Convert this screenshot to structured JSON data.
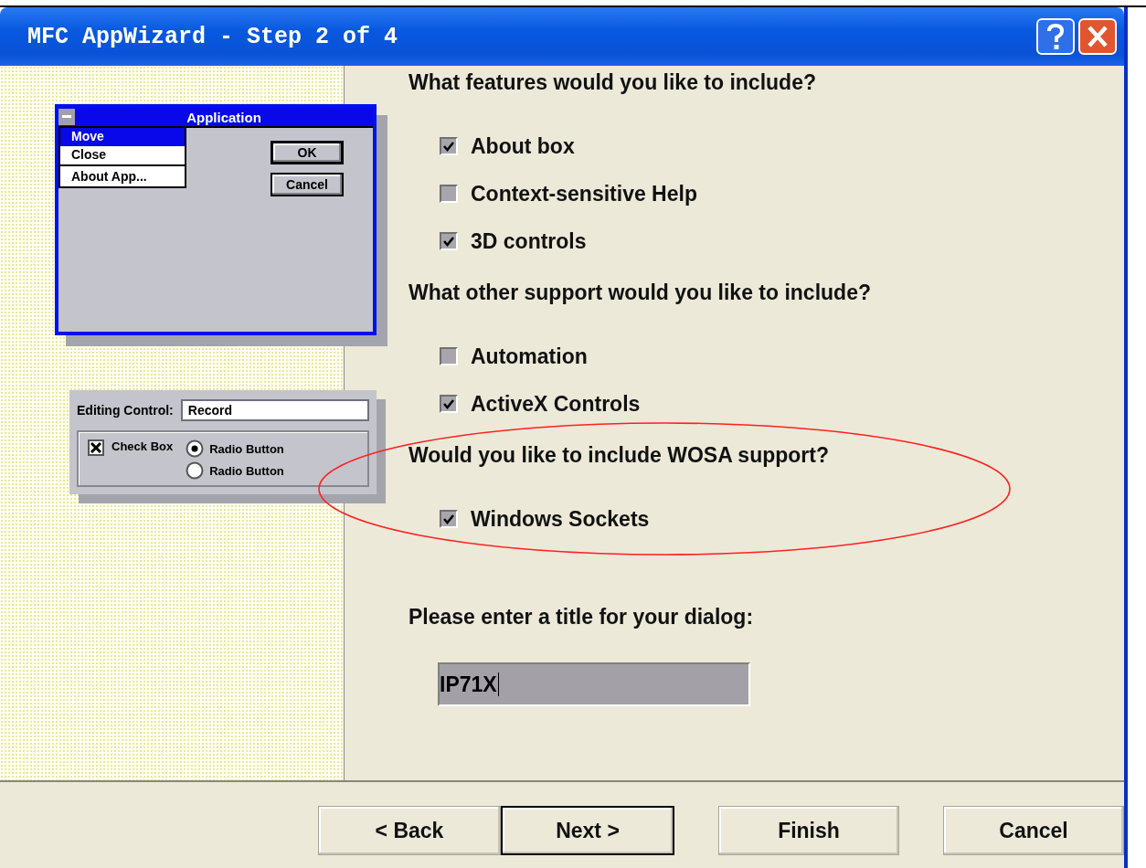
{
  "window": {
    "title": "MFC AppWizard - Step 2 of 4"
  },
  "preview": {
    "window_title": "Application",
    "menu": [
      {
        "label": "Move",
        "selected": true
      },
      {
        "label": "Close",
        "selected": false
      },
      {
        "label": "About App...",
        "selected": false
      }
    ],
    "buttons": [
      {
        "label": "OK",
        "default": true
      },
      {
        "label": "Cancel",
        "default": false
      }
    ],
    "editing_label": "Editing Control:",
    "editing_value": "Record",
    "checkbox": {
      "label": "Check Box",
      "checked": true
    },
    "radios": [
      {
        "label": "Radio Button",
        "selected": true
      },
      {
        "label": "Radio Button",
        "selected": false
      }
    ]
  },
  "sections": [
    {
      "question": "What features would you like to include?",
      "options": [
        {
          "label": "About box",
          "checked": true
        },
        {
          "label": "Context-sensitive Help",
          "checked": false
        },
        {
          "label": "3D controls",
          "checked": true
        }
      ]
    },
    {
      "question": "What other support would you like to include?",
      "options": [
        {
          "label": "Automation",
          "checked": false
        },
        {
          "label": "ActiveX Controls",
          "checked": true
        }
      ]
    },
    {
      "question": "Would you like to include WOSA support?",
      "options": [
        {
          "label": "Windows Sockets",
          "checked": true
        }
      ]
    }
  ],
  "title_prompt": "Please enter a title for your dialog:",
  "title_value": "IP71X",
  "buttons": [
    {
      "label": "< Back",
      "default": false
    },
    {
      "label": "Next >",
      "default": true
    },
    {
      "label": "Finish",
      "default": false
    },
    {
      "label": "Cancel",
      "default": false
    }
  ]
}
